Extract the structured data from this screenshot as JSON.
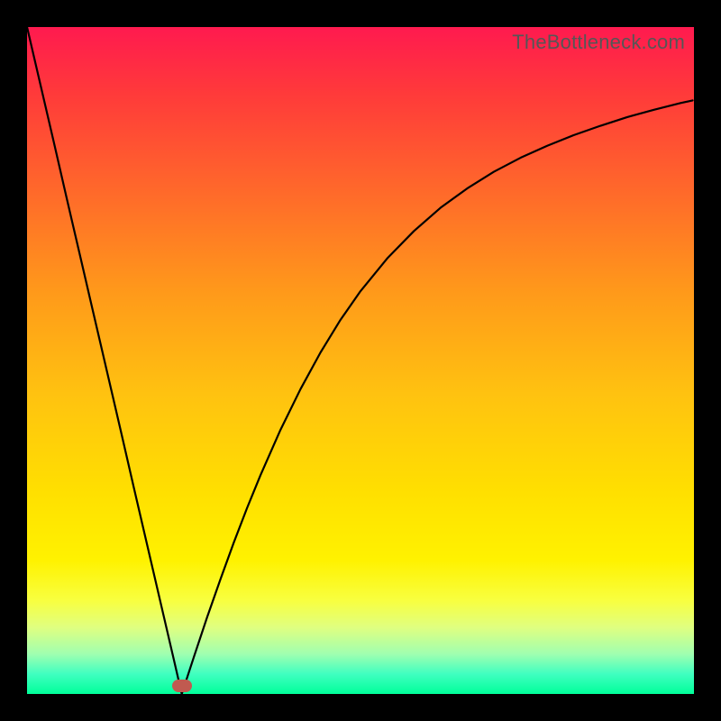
{
  "watermark": "TheBottleneck.com",
  "colors": {
    "frame": "#000000",
    "curve": "#000000",
    "marker": "#c05a50",
    "gradient_top": "#ff1a4f",
    "gradient_bottom": "#00ff9a"
  },
  "chart_data": {
    "type": "line",
    "title": "",
    "xlabel": "",
    "ylabel": "",
    "xlim": [
      0,
      1
    ],
    "ylim": [
      0,
      1
    ],
    "grid": false,
    "legend": false,
    "annotations": [
      {
        "type": "marker",
        "x": 0.232,
        "y": 0.012,
        "shape": "pill",
        "color": "#c05a50"
      }
    ],
    "series": [
      {
        "name": "curve",
        "color": "#000000",
        "x": [
          0.0,
          0.02,
          0.04,
          0.06,
          0.08,
          0.1,
          0.12,
          0.14,
          0.16,
          0.18,
          0.2,
          0.22,
          0.232,
          0.25,
          0.27,
          0.29,
          0.31,
          0.33,
          0.35,
          0.38,
          0.41,
          0.44,
          0.47,
          0.5,
          0.54,
          0.58,
          0.62,
          0.66,
          0.7,
          0.74,
          0.78,
          0.82,
          0.86,
          0.9,
          0.94,
          0.98,
          0.998
        ],
        "y": [
          1.0,
          0.914,
          0.828,
          0.741,
          0.655,
          0.569,
          0.483,
          0.397,
          0.31,
          0.224,
          0.138,
          0.052,
          0.0,
          0.055,
          0.115,
          0.172,
          0.227,
          0.279,
          0.328,
          0.396,
          0.457,
          0.512,
          0.561,
          0.604,
          0.653,
          0.694,
          0.729,
          0.758,
          0.783,
          0.804,
          0.822,
          0.838,
          0.852,
          0.865,
          0.876,
          0.886,
          0.89
        ]
      }
    ]
  }
}
